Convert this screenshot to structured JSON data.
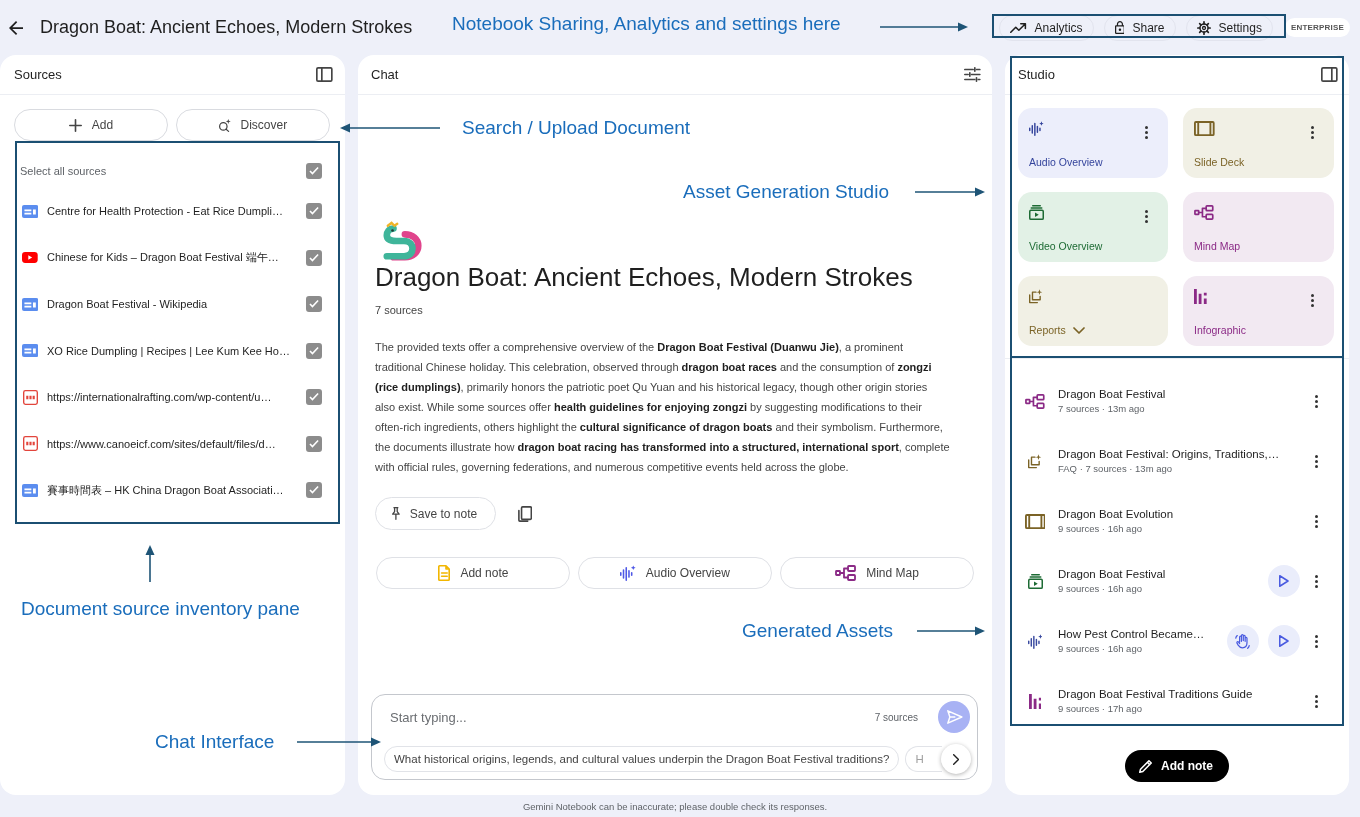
{
  "header": {
    "title": "Dragon Boat: Ancient Echoes, Modern Strokes",
    "actions": [
      {
        "label": "Analytics",
        "kind": "analytics"
      },
      {
        "label": "Share",
        "kind": "share"
      },
      {
        "label": "Settings",
        "kind": "settings"
      }
    ],
    "badge": "ENTERPRISE"
  },
  "sources": {
    "title": "Sources",
    "buttons": [
      {
        "label": "Add",
        "kind": "add"
      },
      {
        "label": "Discover",
        "kind": "discover"
      }
    ],
    "select_all": {
      "label": "Select all sources",
      "checked": true
    },
    "items": [
      {
        "title": "Centre for Health Protection - Eat Rice Dumpli…",
        "kind": "web",
        "checked": true
      },
      {
        "title": "Chinese for Kids – Dragon Boat Festival 端午…",
        "kind": "youtube",
        "checked": true
      },
      {
        "title": "Dragon Boat Festival - Wikipedia",
        "kind": "web",
        "checked": true
      },
      {
        "title": "XO Rice Dumpling | Recipes | Lee Kum Kee Ho…",
        "kind": "web",
        "checked": true
      },
      {
        "title": "https://internationalrafting.com/wp-content/u…",
        "kind": "pdf",
        "checked": true
      },
      {
        "title": "https://www.canoeicf.com/sites/default/files/d…",
        "kind": "pdf",
        "checked": true
      },
      {
        "title": "賽事時間表 – HK China Dragon Boat Associati…",
        "kind": "web",
        "checked": true
      }
    ]
  },
  "chat": {
    "title": "Chat",
    "notebook_title": "Dragon Boat: Ancient Echoes, Modern Strokes",
    "source_count": "7 sources",
    "summary": "The provided texts offer a comprehensive overview of the **Dragon Boat Festival (Duanwu Jie)**, a prominent traditional Chinese holiday. This celebration, observed through **dragon boat races** and the consumption of **zongzi (rice dumplings)**, primarily honors the patriotic poet Qu Yuan and his historical legacy, though other origin stories also exist. While some sources offer **health guidelines for enjoying zongzi** by suggesting modifications to their often-rich ingredients, others highlight the **cultural significance of dragon boats** and their symbolism. Furthermore, the documents illustrate how **dragon boat racing has transformed into a structured, international sport**, complete with official rules, governing federations, and numerous competitive events held across the globe.",
    "save_button": "Save to note",
    "quick_actions": [
      {
        "label": "Add note",
        "kind": "note"
      },
      {
        "label": "Audio Overview",
        "kind": "audio"
      },
      {
        "label": "Mind Map",
        "kind": "mindmap"
      }
    ],
    "composer": {
      "placeholder": "Start typing...",
      "source_count": "7 sources",
      "suggestions": [
        "What historical origins, legends, and cultural values underpin the Dragon Boat Festival traditions?",
        "H"
      ]
    }
  },
  "studio": {
    "title": "Studio",
    "tools": [
      {
        "label": "Audio Overview",
        "kind": "audio",
        "menu": true,
        "dropdown": false
      },
      {
        "label": "Slide Deck",
        "kind": "slides",
        "menu": true,
        "dropdown": false
      },
      {
        "label": "Video Overview",
        "kind": "video",
        "menu": true,
        "dropdown": false
      },
      {
        "label": "Mind Map",
        "kind": "mindmap",
        "menu": false,
        "dropdown": false
      },
      {
        "label": "Reports",
        "kind": "reports",
        "menu": false,
        "dropdown": true
      },
      {
        "label": "Infographic",
        "kind": "infographic",
        "menu": true,
        "dropdown": false
      }
    ],
    "assets": [
      {
        "title": "Dragon Boat Festival",
        "meta": "7 sources · 13m ago",
        "kind": "mindmap",
        "playable": false,
        "interactive": false
      },
      {
        "title": "Dragon Boat Festival: Origins, Traditions,…",
        "meta": "FAQ · 7 sources · 13m ago",
        "kind": "reports",
        "playable": false,
        "interactive": false
      },
      {
        "title": "Dragon Boat Evolution",
        "meta": "9 sources · 16h ago",
        "kind": "slides",
        "playable": false,
        "interactive": false
      },
      {
        "title": "Dragon Boat Festival",
        "meta": "9 sources · 16h ago",
        "kind": "video",
        "playable": true,
        "interactive": false
      },
      {
        "title": "How Pest Control Became…",
        "meta": "9 sources · 16h ago",
        "kind": "audio",
        "playable": true,
        "interactive": true
      },
      {
        "title": "Dragon Boat Festival Traditions Guide",
        "meta": "9 sources · 17h ago",
        "kind": "infographic",
        "playable": false,
        "interactive": false
      }
    ],
    "add_note": "Add note"
  },
  "disclaimer": "Gemini Notebook can be inaccurate; please double check its responses.",
  "annotations": [
    {
      "text": "Notebook Sharing, Analytics and settings here",
      "kind": "right"
    },
    {
      "text": "Search / Upload Document",
      "kind": "left"
    },
    {
      "text": "Asset Generation Studio",
      "kind": "right"
    },
    {
      "text": "Document source inventory pane",
      "kind": "up"
    },
    {
      "text": "Generated Assets",
      "kind": "right"
    },
    {
      "text": "Chat Interface",
      "kind": "right"
    }
  ]
}
